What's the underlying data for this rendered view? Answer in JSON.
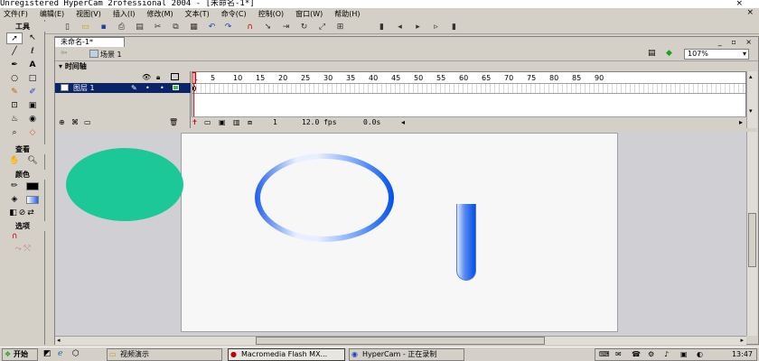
{
  "titlebar": {
    "title": "Unregistered HyperCam 2rofessional 2004 - [未命名-1*]",
    "close": "×"
  },
  "menubar": {
    "items": [
      "文件(F)",
      "编辑(E)",
      "视图(V)",
      "插入(I)",
      "修改(M)",
      "文本(T)",
      "命令(C)",
      "控制(O)",
      "窗口(W)",
      "帮助(H)"
    ],
    "close": "×"
  },
  "tools": {
    "header": "工具",
    "view_header": "查看",
    "color_header": "颜色",
    "options_header": "选项"
  },
  "document": {
    "tab": "未命名-1*",
    "scene": "场景 1",
    "zoom": "107%",
    "window_buttons": "_ ▫ ×"
  },
  "timeline": {
    "header": "时间轴",
    "layer_name": "图层 1",
    "frame_numbers": [
      "1",
      "5",
      "10",
      "15",
      "20",
      "25",
      "30",
      "35",
      "40",
      "45",
      "50",
      "55",
      "60",
      "65",
      "70",
      "75",
      "80",
      "85",
      "90"
    ],
    "current_frame": "1",
    "fps": "12.0 fps",
    "time": "0.0s"
  },
  "taskbar": {
    "start": "开始",
    "tasks": [
      "视频演示",
      "Macromedia Flash MX...",
      "HyperCam - 正在录制"
    ],
    "clock": "13:47"
  },
  "colors": {
    "ellipse": "#1cc897",
    "ring": "#0050e8",
    "stage": "#f7f7f7"
  }
}
